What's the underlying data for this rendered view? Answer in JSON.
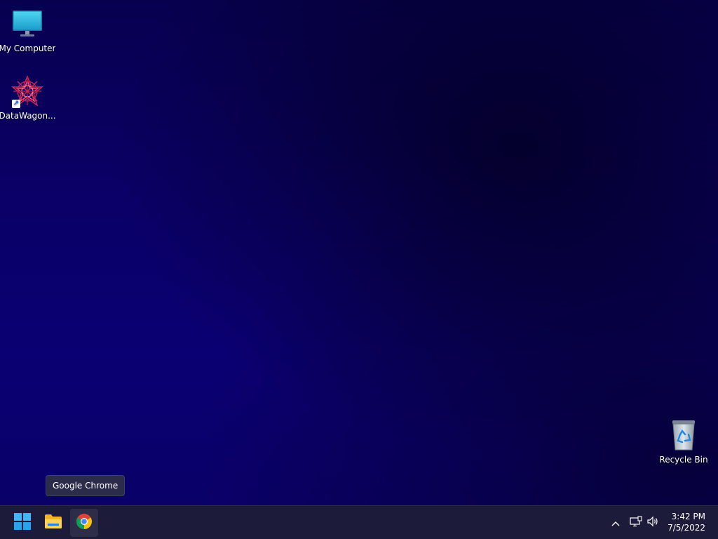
{
  "desktop": {
    "icons": [
      {
        "label": "My Computer",
        "icon": "monitor-icon"
      },
      {
        "label": "DataWagon...",
        "icon": "datawagon-app-icon"
      },
      {
        "label": "Recycle Bin",
        "icon": "recycle-bin-icon"
      }
    ]
  },
  "tooltip": {
    "text": "Google Chrome"
  },
  "taskbar": {
    "apps": [
      {
        "name": "Start",
        "icon": "windows-start-icon"
      },
      {
        "name": "File Explorer",
        "icon": "folder-icon"
      },
      {
        "name": "Google Chrome",
        "icon": "chrome-icon"
      }
    ],
    "tray": {
      "icons": [
        "chevron-up-icon",
        "network-icon",
        "volume-icon"
      ]
    },
    "clock": {
      "time": "3:42 PM",
      "date": "7/5/2022"
    }
  },
  "colors": {
    "wallpaper": "#0a0066",
    "taskbar": "#1c1c3a",
    "accent": "#0078d4"
  }
}
